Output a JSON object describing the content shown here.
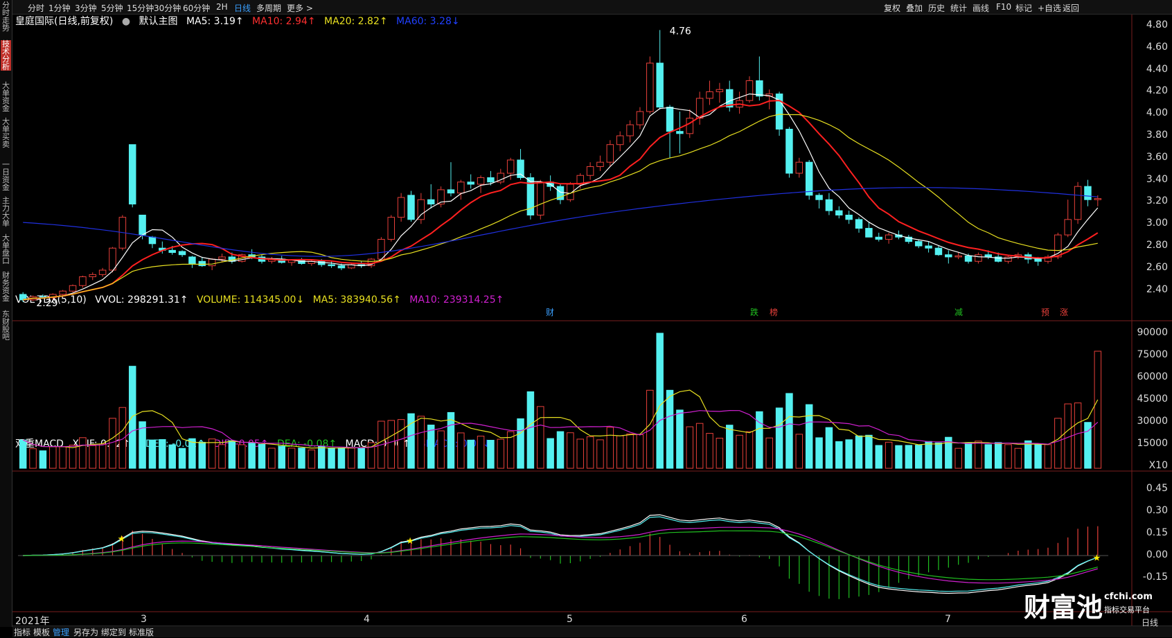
{
  "sidebar": {
    "items": [
      {
        "label": "分时走势",
        "active": false
      },
      {
        "label": "技术分析",
        "active": true
      },
      {
        "label": "大单资金",
        "active": false
      },
      {
        "label": "大单买卖",
        "active": false
      },
      {
        "label": "一日资金",
        "active": false
      },
      {
        "label": "主力大单",
        "active": false
      },
      {
        "label": "大单盘口",
        "active": false
      },
      {
        "label": "财务资金",
        "active": false
      },
      {
        "label": "东财股吧",
        "active": false
      }
    ]
  },
  "topbar": {
    "periods": [
      "分时",
      "1分钟",
      "3分钟",
      "5分钟",
      "15分钟",
      "30分钟",
      "60分钟",
      "2H",
      "日线",
      "多周期",
      "更多 >"
    ],
    "active_period": "日线",
    "tools": [
      "复权",
      "叠加",
      "历史",
      "统计",
      "画线",
      "F10",
      "标记",
      "+自选",
      "返回"
    ]
  },
  "main_legend": {
    "title": "皇庭国际(日线,前复权)",
    "chart_name": "默认主图",
    "ma5": "MA5: 3.19↑",
    "ma10": "MA10: 2.94↑",
    "ma20": "MA20: 2.82↑",
    "ma60": "MA60: 3.28↓"
  },
  "main_axis": [
    "4.80",
    "4.60",
    "4.40",
    "4.20",
    "4.00",
    "3.80",
    "3.60",
    "3.40",
    "3.20",
    "3.00",
    "2.80",
    "2.60",
    "2.40"
  ],
  "main_annotations": {
    "high": "4.76",
    "low": "2.29"
  },
  "event_markers": [
    "财",
    "跌",
    "榜",
    "减",
    "预",
    "涨"
  ],
  "vol_legend": {
    "name": "VOL-TDX(5,10)",
    "vvol": "VVOL: 298291.31↑",
    "volume": "VOLUME: 114345.00↓",
    "ma5": "MA5: 383940.56↑",
    "ma10": "MA10: 239314.25↑"
  },
  "vol_axis": [
    "90000",
    "75000",
    "60000",
    "45000",
    "30000",
    "15000",
    "X10"
  ],
  "macd_legend": {
    "name": "双重MACD",
    "xdif": "XDIF: 0.02↑",
    "xdea": "XDEA: -0.02↑",
    "dif": "DIF: -0.05↑",
    "dea": "DEA: -0.08↑",
    "macd": "MACD: 0.06↑",
    "bmacd": "BMACD: 0.05↓"
  },
  "macd_axis": [
    "0.45",
    "0.30",
    "0.15",
    "0.00",
    "-0.15"
  ],
  "dates": [
    "2021年",
    "3",
    "4",
    "5",
    "6",
    "7"
  ],
  "bottombar": {
    "tabs": [
      "指标",
      "模板",
      "管理",
      "另存为",
      "绑定到",
      "标准版"
    ],
    "active_tab": "管理",
    "right_label": "日线"
  },
  "watermark": {
    "brand": "财富池",
    "site": "cfchi.com",
    "tagline": "指标交易平台"
  },
  "colors": {
    "up": "#e8403a",
    "down": "#54f0f0",
    "ma5": "#ffffff",
    "ma10": "#ff2020",
    "ma20": "#e8e020",
    "ma60": "#2030e0",
    "vma10": "#d020d0",
    "dea": "#20c020"
  },
  "chart_data": {
    "type": "candlestick",
    "title": "皇庭国际(日线,前复权)",
    "ylim": [
      2.25,
      4.85
    ],
    "candles": [
      [
        2.36,
        2.38,
        2.29,
        2.31
      ],
      [
        2.31,
        2.35,
        2.3,
        2.34
      ],
      [
        2.34,
        2.36,
        2.32,
        2.33
      ],
      [
        2.33,
        2.37,
        2.31,
        2.36
      ],
      [
        2.36,
        2.4,
        2.34,
        2.39
      ],
      [
        2.39,
        2.45,
        2.38,
        2.44
      ],
      [
        2.44,
        2.53,
        2.42,
        2.52
      ],
      [
        2.52,
        2.56,
        2.49,
        2.54
      ],
      [
        2.54,
        2.6,
        2.52,
        2.58
      ],
      [
        2.58,
        2.79,
        2.56,
        2.78
      ],
      [
        2.78,
        3.08,
        2.76,
        3.06
      ],
      [
        3.72,
        3.72,
        3.15,
        3.18
      ],
      [
        3.08,
        3.08,
        2.86,
        2.9
      ],
      [
        2.88,
        2.89,
        2.78,
        2.82
      ],
      [
        2.78,
        2.84,
        2.73,
        2.76
      ],
      [
        2.76,
        2.8,
        2.72,
        2.74
      ],
      [
        2.75,
        2.76,
        2.7,
        2.72
      ],
      [
        2.7,
        2.71,
        2.6,
        2.64
      ],
      [
        2.66,
        2.7,
        2.61,
        2.62
      ],
      [
        2.62,
        2.69,
        2.58,
        2.68
      ],
      [
        2.68,
        2.73,
        2.65,
        2.7
      ],
      [
        2.7,
        2.74,
        2.64,
        2.66
      ],
      [
        2.66,
        2.73,
        2.65,
        2.72
      ],
      [
        2.72,
        2.77,
        2.68,
        2.7
      ],
      [
        2.7,
        2.72,
        2.64,
        2.66
      ],
      [
        2.66,
        2.7,
        2.64,
        2.68
      ],
      [
        2.68,
        2.71,
        2.64,
        2.65
      ],
      [
        2.65,
        2.68,
        2.62,
        2.67
      ],
      [
        2.67,
        2.69,
        2.63,
        2.64
      ],
      [
        2.64,
        2.67,
        2.62,
        2.66
      ],
      [
        2.66,
        2.68,
        2.61,
        2.63
      ],
      [
        2.63,
        2.66,
        2.6,
        2.62
      ],
      [
        2.62,
        2.64,
        2.58,
        2.6
      ],
      [
        2.6,
        2.65,
        2.59,
        2.63
      ],
      [
        2.63,
        2.66,
        2.6,
        2.62
      ],
      [
        2.62,
        2.69,
        2.6,
        2.68
      ],
      [
        2.68,
        2.88,
        2.66,
        2.86
      ],
      [
        2.86,
        3.08,
        2.84,
        3.06
      ],
      [
        3.06,
        3.28,
        3.02,
        3.24
      ],
      [
        3.26,
        3.3,
        3.02,
        3.04
      ],
      [
        3.04,
        3.28,
        3.0,
        3.22
      ],
      [
        3.22,
        3.36,
        3.14,
        3.18
      ],
      [
        3.18,
        3.34,
        3.15,
        3.31
      ],
      [
        3.31,
        3.56,
        3.25,
        3.28
      ],
      [
        3.28,
        3.4,
        3.22,
        3.38
      ],
      [
        3.38,
        3.45,
        3.32,
        3.36
      ],
      [
        3.36,
        3.44,
        3.28,
        3.42
      ],
      [
        3.42,
        3.48,
        3.35,
        3.38
      ],
      [
        3.38,
        3.5,
        3.36,
        3.46
      ],
      [
        3.46,
        3.6,
        3.4,
        3.58
      ],
      [
        3.58,
        3.68,
        3.4,
        3.42
      ],
      [
        3.42,
        3.46,
        3.04,
        3.08
      ],
      [
        3.08,
        3.4,
        3.04,
        3.38
      ],
      [
        3.38,
        3.44,
        3.3,
        3.34
      ],
      [
        3.34,
        3.36,
        3.18,
        3.22
      ],
      [
        3.22,
        3.38,
        3.2,
        3.36
      ],
      [
        3.36,
        3.46,
        3.32,
        3.44
      ],
      [
        3.44,
        3.56,
        3.4,
        3.52
      ],
      [
        3.52,
        3.62,
        3.48,
        3.56
      ],
      [
        3.56,
        3.76,
        3.52,
        3.72
      ],
      [
        3.72,
        3.84,
        3.66,
        3.8
      ],
      [
        3.8,
        3.94,
        3.74,
        3.9
      ],
      [
        3.9,
        4.06,
        3.86,
        4.02
      ],
      [
        4.02,
        4.52,
        4.0,
        4.46
      ],
      [
        4.46,
        4.76,
        4.04,
        4.06
      ],
      [
        4.06,
        4.08,
        3.6,
        3.84
      ],
      [
        3.84,
        4.02,
        3.64,
        3.82
      ],
      [
        3.82,
        4.04,
        3.78,
        3.96
      ],
      [
        3.96,
        4.2,
        3.9,
        4.14
      ],
      [
        4.14,
        4.3,
        4.08,
        4.2
      ],
      [
        4.2,
        4.28,
        4.1,
        4.22
      ],
      [
        4.22,
        4.3,
        4.02,
        4.06
      ],
      [
        4.06,
        4.2,
        4.0,
        4.12
      ],
      [
        4.12,
        4.34,
        4.1,
        4.3
      ],
      [
        4.3,
        4.52,
        4.12,
        4.16
      ],
      [
        4.16,
        4.22,
        4.04,
        4.18
      ],
      [
        4.18,
        4.2,
        3.8,
        3.86
      ],
      [
        3.86,
        3.88,
        3.42,
        3.46
      ],
      [
        3.46,
        3.6,
        3.42,
        3.56
      ],
      [
        3.56,
        3.58,
        3.22,
        3.26
      ],
      [
        3.26,
        3.28,
        3.14,
        3.22
      ],
      [
        3.22,
        3.28,
        3.08,
        3.12
      ],
      [
        3.12,
        3.16,
        3.05,
        3.08
      ],
      [
        3.08,
        3.12,
        3.0,
        3.04
      ],
      [
        3.04,
        3.06,
        2.92,
        2.96
      ],
      [
        2.96,
        3.02,
        2.88,
        2.88
      ],
      [
        2.88,
        2.92,
        2.84,
        2.86
      ],
      [
        2.86,
        2.92,
        2.82,
        2.9
      ],
      [
        2.9,
        2.94,
        2.86,
        2.88
      ],
      [
        2.88,
        2.9,
        2.82,
        2.84
      ],
      [
        2.84,
        2.86,
        2.78,
        2.8
      ],
      [
        2.8,
        2.84,
        2.74,
        2.78
      ],
      [
        2.78,
        2.8,
        2.71,
        2.72
      ],
      [
        2.72,
        2.76,
        2.64,
        2.7
      ],
      [
        2.7,
        2.74,
        2.68,
        2.71
      ],
      [
        2.71,
        2.73,
        2.64,
        2.66
      ],
      [
        2.66,
        2.74,
        2.64,
        2.72
      ],
      [
        2.72,
        2.76,
        2.68,
        2.7
      ],
      [
        2.7,
        2.74,
        2.65,
        2.66
      ],
      [
        2.66,
        2.72,
        2.64,
        2.7
      ],
      [
        2.7,
        2.74,
        2.68,
        2.72
      ],
      [
        2.72,
        2.74,
        2.64,
        2.68
      ],
      [
        2.68,
        2.7,
        2.62,
        2.66
      ],
      [
        2.66,
        2.72,
        2.64,
        2.7
      ],
      [
        2.7,
        2.92,
        2.68,
        2.9
      ],
      [
        2.9,
        3.22,
        2.88,
        3.04
      ],
      [
        3.04,
        3.38,
        3.0,
        3.34
      ],
      [
        3.34,
        3.4,
        3.16,
        3.22
      ],
      [
        3.22,
        3.26,
        3.16,
        3.23
      ]
    ],
    "volume_ylim": [
      0,
      100000
    ],
    "macd_ylim": [
      -0.28,
      0.52
    ]
  }
}
